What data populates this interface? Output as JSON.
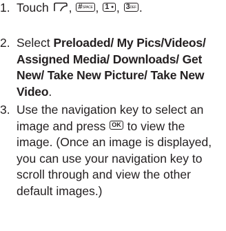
{
  "steps": [
    {
      "number": "1.",
      "text_before": "Touch",
      "sep1": ",",
      "sep2": ",",
      "sep3": ",",
      "text_after": ".",
      "keys": {
        "menu_icon": "menu-key-icon",
        "pound": {
          "main": "#",
          "sub": "SPACE"
        },
        "one": {
          "main": "1",
          "sub": "●"
        },
        "three": {
          "main": "3",
          "sub": "DEF"
        }
      }
    },
    {
      "number": "2.",
      "text_before": "Select",
      "options": "Preloaded/ My Pics/Videos/ Assigned Media/ Downloads/ Get New/ Take New Picture/ Take New Video",
      "text_after": "."
    },
    {
      "number": "3.",
      "text_before": "Use the navigation key to select an image and press",
      "key_ok": "OK",
      "text_after": "to view the image. (Once an image is displayed, you can use your navigation key to scroll through and view the other default images.)"
    }
  ]
}
